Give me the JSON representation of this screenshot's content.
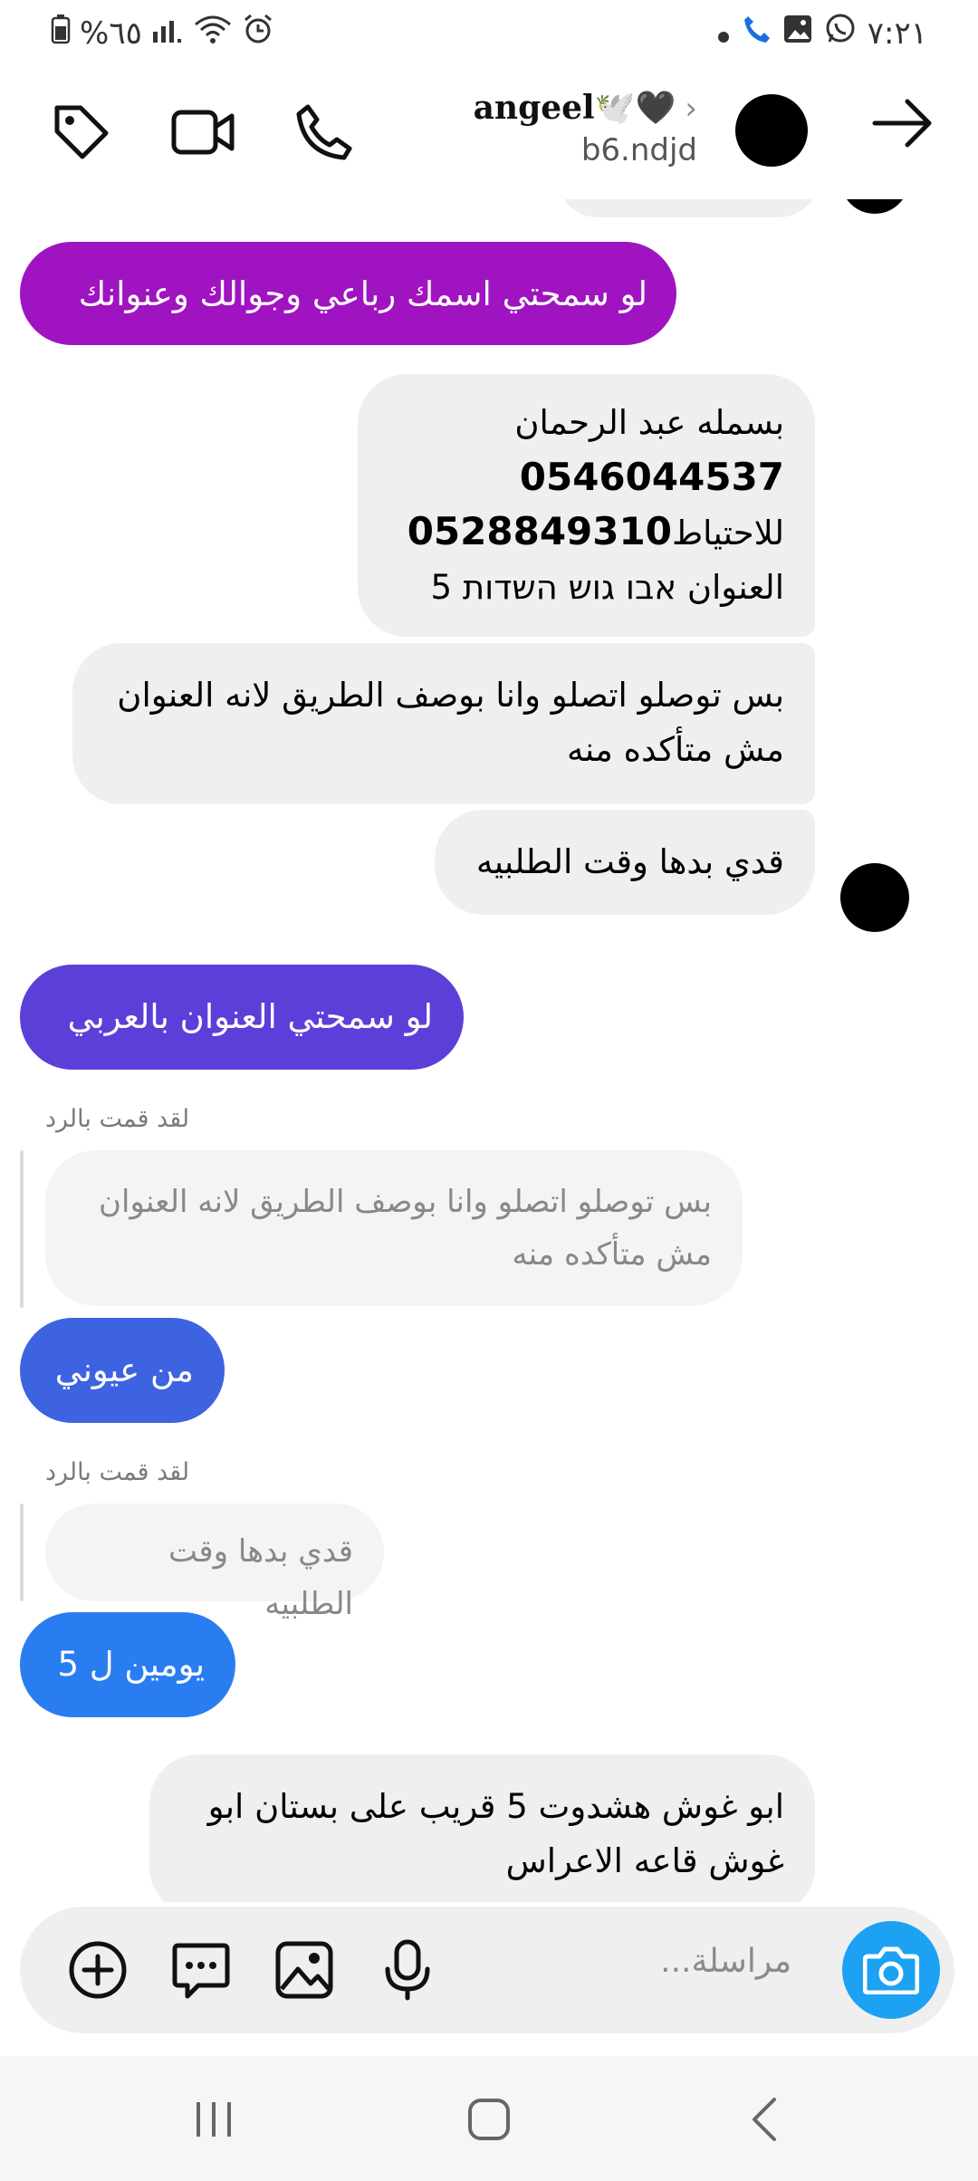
{
  "status_bar": {
    "battery_text": "%٦٥",
    "time": "٧:٢١",
    "icons": [
      "battery-icon",
      "signal-icon",
      "wifi-icon",
      "alarm-icon",
      "dot-icon",
      "call-icon",
      "gallery-icon",
      "whatsapp-icon"
    ]
  },
  "header": {
    "contact_name": "angeel🕊️🖤",
    "chevron": "›",
    "handle": "b6.ndjd",
    "icons": [
      "tag-icon",
      "video-call-icon",
      "phone-icon",
      "avatar",
      "back-arrow-icon"
    ]
  },
  "messages": {
    "m1": "لو سمحتي اسمك رباعي وجوالك وعنوانك",
    "m2_line1": "بسمله عبد الرحمان",
    "m2_line2": "0546044537",
    "m2_line3_a": "للاحتياط",
    "m2_line3_b": "0528849310",
    "m2_line4": "العنوان  אבו גוש השדות 5",
    "m3_line1": "بس توصلو اتصلو وانا بوصف الطريق لانه العنوان",
    "m3_line2": "مش متأكده منه",
    "m4": "قدي بدها وقت الطلبيه",
    "m5": "لو سمحتي  العنوان بالعربي",
    "reply1_label": "لقد قمت بالرد",
    "reply1_quote_line1": "بس توصلو اتصلو وانا بوصف الطريق لانه العنوان",
    "reply1_quote_line2": "مش متأكده منه",
    "m6": "من عيوني",
    "reply2_label": "لقد قمت بالرد",
    "reply2_quote": "قدي بدها وقت الطلبيه",
    "m7": "يومين ل 5",
    "m8_line1": "ابو غوش هشدوت 5 قريب على بستان ابو",
    "m8_line2": "غوش قاعه الاعراس"
  },
  "colors": {
    "m1": "#a013c0",
    "m5": "#5b3fd8",
    "m6": "#3d63e0",
    "m7": "#2a7df0",
    "camera": "#1da1f2"
  },
  "composer": {
    "placeholder": "مراسلة...",
    "icons": [
      "add-icon",
      "sticker-chat-icon",
      "image-icon",
      "mic-icon",
      "camera-icon"
    ]
  },
  "nav": {
    "icons": [
      "recent-apps-icon",
      "home-icon",
      "back-icon"
    ]
  }
}
